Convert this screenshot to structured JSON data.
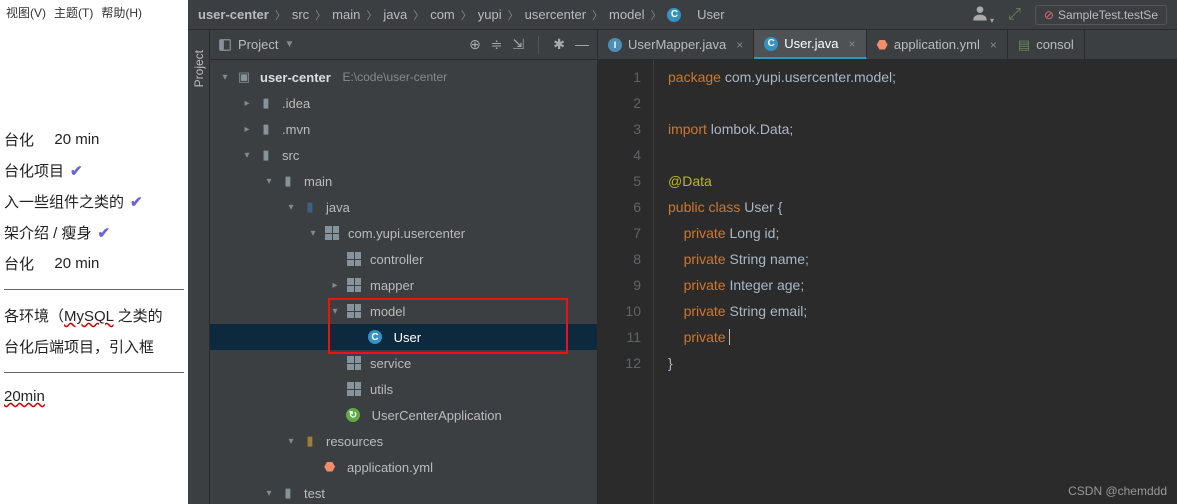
{
  "menu": {
    "view": "视图(V)",
    "theme": "主题(T)",
    "help": "帮助(H)"
  },
  "notes": {
    "l1a": "台化",
    "l1b": "20 min",
    "l2": "台化项目",
    "l3": "入一些组件之类的",
    "l4": "架介绍 / 瘦身",
    "l5a": "台化",
    "l5b": "20 min",
    "l6a": "各环境（",
    "l6b": "MySQL",
    "l6c": " 之类的",
    "l7": "台化后端项目，引入框",
    "l8": "20min"
  },
  "breadcrumb": [
    "user-center",
    "src",
    "main",
    "java",
    "com",
    "yupi",
    "usercenter",
    "model"
  ],
  "breadcrumb_last": "User",
  "run_config": "SampleTest.testSe",
  "project_label": "Project",
  "toolstrip": "Project",
  "tree": {
    "root": "user-center",
    "root_path": "E:\\code\\user-center",
    "idea": ".idea",
    "mvn": ".mvn",
    "src": "src",
    "main": "main",
    "java": "java",
    "pkg": "com.yupi.usercenter",
    "controller": "controller",
    "mapper": "mapper",
    "model": "model",
    "user": "User",
    "service": "service",
    "utils": "utils",
    "app": "UserCenterApplication",
    "resources": "resources",
    "appyml": "application.yml",
    "test": "test"
  },
  "tabs": {
    "t1": "UserMapper.java",
    "t2": "User.java",
    "t3": "application.yml",
    "t4": "consol"
  },
  "code": {
    "package_kw": "package ",
    "package_val": "com.yupi.usercenter.model",
    "import_kw": "import ",
    "import_val": "lombok.Data",
    "ann": "@Data",
    "public": "public ",
    "class_kw": "class ",
    "cls": "User",
    "priv": "private ",
    "t_long": "Long ",
    "t_str": "String ",
    "t_int": "Integer ",
    "f_id": "id",
    "f_name": "name",
    "f_age": "age",
    "f_email": "email"
  },
  "watermark": "CSDN @chemddd"
}
